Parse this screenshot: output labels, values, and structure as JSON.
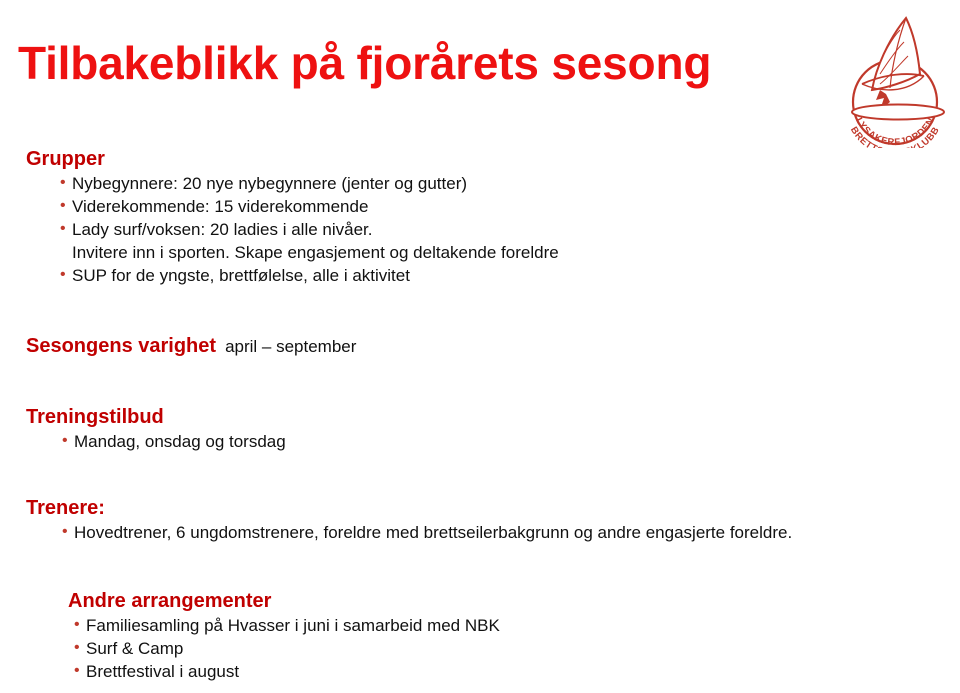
{
  "slide": {
    "title": "Tilbakeblikk på fjorårets sesong",
    "colors": {
      "title_red": "#EE1111",
      "heading_red": "#C00000",
      "bullet_red": "#C0392B",
      "body_black": "#111111",
      "background": "#FFFFFF"
    }
  },
  "logo": {
    "name": "lysakerfjorden-brettseilerklubb-logo",
    "text_top": "LYSAKERFJORDEN",
    "text_bottom": "BRETTSEILERKLUBB",
    "color": "#C0392B"
  },
  "sections": [
    {
      "heading": "Grupper",
      "items": [
        {
          "text": "Nybegynnere: 20 nye nybegynnere  (jenter og gutter)",
          "bulleted": true
        },
        {
          "text": "Viderekommende: 15  viderekommende",
          "bulleted": true
        },
        {
          "text": "Lady surf/voksen: 20 ladies i alle nivåer.",
          "bulleted": true
        },
        {
          "text": "Invitere inn i sporten. Skape engasjement og deltakende foreldre",
          "bulleted": false
        },
        {
          "text": "SUP for de yngste, brettfølelse, alle i aktivitet",
          "bulleted": true
        }
      ]
    },
    {
      "heading": "Sesongens varighet",
      "note": "april – september",
      "items": []
    },
    {
      "heading": "Treningstilbud",
      "items": [
        {
          "text": "Mandag, onsdag og torsdag",
          "bulleted": true
        }
      ]
    },
    {
      "heading": "Trenere:",
      "items": [
        {
          "text": "Hovedtrener, 6 ungdomstrenere, foreldre med brettseilerbakgrunn og andre engasjerte foreldre.",
          "bulleted": true
        }
      ]
    },
    {
      "heading": "Andre arrangementer",
      "items": [
        {
          "text": "Familiesamling på Hvasser i juni i samarbeid med NBK",
          "bulleted": true
        },
        {
          "text": "Surf & Camp",
          "bulleted": true
        },
        {
          "text": "Brettfestival i august",
          "bulleted": true
        }
      ]
    }
  ]
}
